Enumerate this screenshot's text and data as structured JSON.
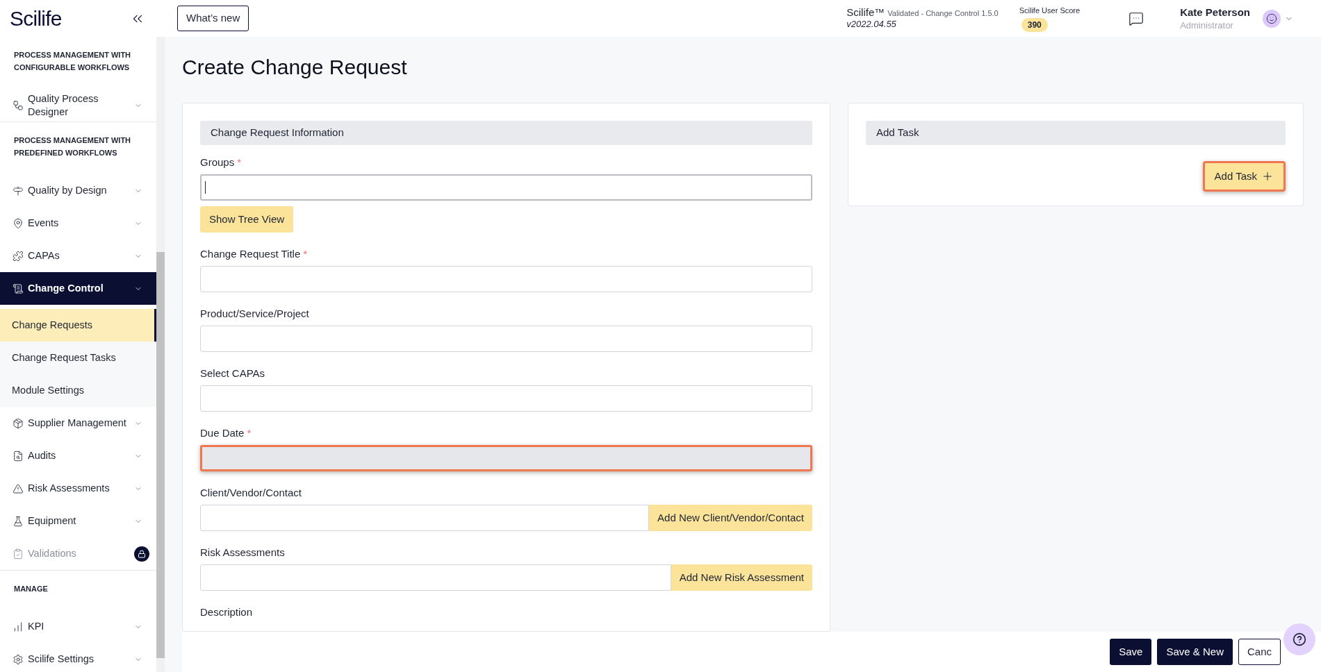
{
  "sidebar": {
    "logo": "Scilife",
    "sections": [
      {
        "heading": "PROCESS MANAGEMENT WITH CONFIGURABLE WORKFLOWS",
        "items": [
          {
            "label": "Quality Process Designer",
            "selected": false,
            "expanded": false,
            "disabled": false
          }
        ]
      },
      {
        "heading": "PROCESS MANAGEMENT WITH PREDEFINED WORKFLOWS",
        "items": [
          {
            "label": "Quality by Design",
            "selected": false,
            "expanded": false,
            "disabled": false
          },
          {
            "label": "Events",
            "selected": false,
            "expanded": false,
            "disabled": false
          },
          {
            "label": "CAPAs",
            "selected": false,
            "expanded": false,
            "disabled": false
          },
          {
            "label": "Change Control",
            "selected": true,
            "expanded": true,
            "disabled": false,
            "children": [
              {
                "label": "Change Requests",
                "selected": true
              },
              {
                "label": "Change Request Tasks",
                "selected": false
              },
              {
                "label": "Module Settings",
                "selected": false
              }
            ]
          },
          {
            "label": "Supplier Management",
            "selected": false,
            "expanded": false,
            "disabled": false
          },
          {
            "label": "Audits",
            "selected": false,
            "expanded": false,
            "disabled": false
          },
          {
            "label": "Risk Assessments",
            "selected": false,
            "expanded": false,
            "disabled": false
          },
          {
            "label": "Equipment",
            "selected": false,
            "expanded": false,
            "disabled": false
          },
          {
            "label": "Validations",
            "selected": false,
            "expanded": false,
            "disabled": true
          }
        ]
      },
      {
        "heading": "MANAGE",
        "items": [
          {
            "label": "KPI",
            "selected": false,
            "expanded": false,
            "disabled": false
          },
          {
            "label": "Scilife Settings",
            "selected": false,
            "expanded": false,
            "disabled": false
          }
        ]
      }
    ]
  },
  "topbar": {
    "whats_new": "What’s new",
    "product": "Scilife™",
    "module_version": "Validated - Change Control 1.5.0",
    "version": "v2022.04.55",
    "score_label": "Scilife User Score",
    "score": "390",
    "user_name": "Kate Peterson",
    "user_role": "Administrator"
  },
  "page_title": "Create Change Request",
  "form": {
    "heading": "Change Request Information",
    "fields": [
      {
        "kind": "text",
        "label": "Groups",
        "required_mark": "*",
        "focused": true,
        "disabled": false,
        "highlighted": false,
        "button": "Show Tree View"
      },
      {
        "kind": "text",
        "label": "Change Request Title",
        "required_mark": "*",
        "focused": false,
        "disabled": false,
        "highlighted": false
      },
      {
        "kind": "text",
        "label": "Product/Service/Project",
        "focused": false,
        "disabled": false,
        "highlighted": false
      },
      {
        "kind": "text",
        "label": "Select CAPAs",
        "focused": false,
        "disabled": false,
        "highlighted": false
      },
      {
        "kind": "text",
        "label": "Due Date",
        "required_mark": "*",
        "focused": false,
        "disabled": true,
        "highlighted": true
      },
      {
        "kind": "text_with_button",
        "label": "Client/Vendor/Contact",
        "focused": false,
        "disabled": false,
        "highlighted": false,
        "button": "Add New Client/Vendor/Contact"
      },
      {
        "kind": "text_with_button",
        "label": "Risk Assessments",
        "focused": false,
        "disabled": false,
        "highlighted": false,
        "button": "Add New Risk Assessment"
      },
      {
        "kind": "label",
        "label": "Description"
      }
    ]
  },
  "task_panel": {
    "heading": "Add Task",
    "button": "Add Task",
    "highlighted": true
  },
  "footer": {
    "buttons": [
      {
        "label": "Save",
        "kind": "primary"
      },
      {
        "label": "Save & New",
        "kind": "primary"
      },
      {
        "label": "Canc",
        "kind": "outline"
      }
    ]
  }
}
